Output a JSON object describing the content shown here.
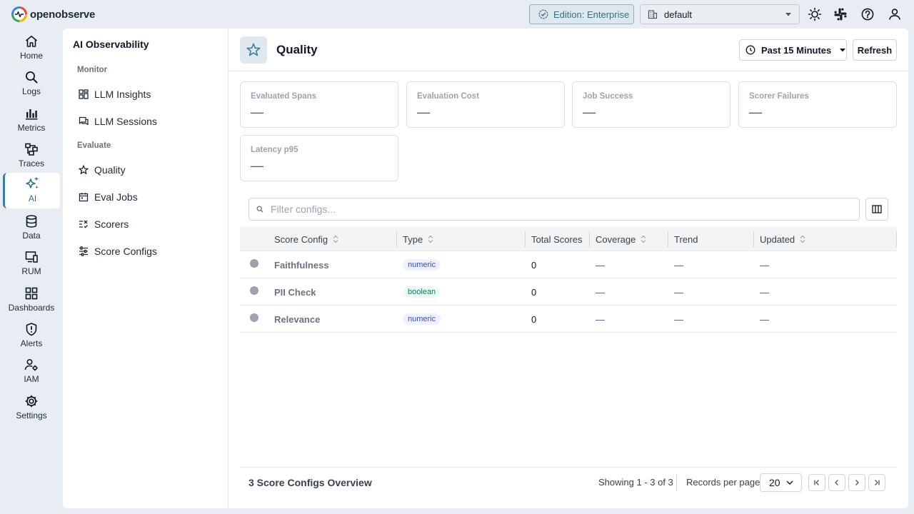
{
  "app": {
    "logo_text": "openobserve"
  },
  "topbar": {
    "edition_label": "Edition: Enterprise",
    "org_name": "default",
    "icons": [
      "theme-sun-icon",
      "slack-icon",
      "help-icon",
      "user-icon"
    ]
  },
  "leftnav": {
    "items": [
      {
        "label": "Home",
        "icon": "home-icon"
      },
      {
        "label": "Logs",
        "icon": "search-icon"
      },
      {
        "label": "Metrics",
        "icon": "bar-chart-icon"
      },
      {
        "label": "Traces",
        "icon": "traces-icon"
      },
      {
        "label": "AI",
        "icon": "sparkles-icon",
        "active": true
      },
      {
        "label": "Data",
        "icon": "database-icon"
      },
      {
        "label": "RUM",
        "icon": "devices-icon"
      },
      {
        "label": "Dashboards",
        "icon": "dashboard-icon"
      },
      {
        "label": "Alerts",
        "icon": "shield-alert-icon"
      },
      {
        "label": "IAM",
        "icon": "users-gear-icon"
      },
      {
        "label": "Settings",
        "icon": "gear-icon"
      }
    ]
  },
  "subnav": {
    "title": "AI Observability",
    "sections": [
      {
        "label": "Monitor",
        "items": [
          {
            "label": "LLM Insights",
            "icon": "grid-icon"
          },
          {
            "label": "LLM Sessions",
            "icon": "chat-icon"
          }
        ]
      },
      {
        "label": "Evaluate",
        "items": [
          {
            "label": "Quality",
            "icon": "star-icon"
          },
          {
            "label": "Eval Jobs",
            "icon": "calendar-icon"
          },
          {
            "label": "Scorers",
            "icon": "checklist-icon"
          },
          {
            "label": "Score Configs",
            "icon": "sliders-icon"
          }
        ]
      }
    ]
  },
  "header": {
    "title": "Quality",
    "time_range": "Past 15 Minutes",
    "refresh_label": "Refresh"
  },
  "cards": [
    {
      "label": "Evaluated Spans",
      "value": "—"
    },
    {
      "label": "Evaluation Cost",
      "value": "—"
    },
    {
      "label": "Job Success",
      "value": "—"
    },
    {
      "label": "Scorer Failures",
      "value": "—"
    },
    {
      "label": "Latency p95",
      "value": "—"
    }
  ],
  "filter": {
    "placeholder": "Filter configs..."
  },
  "table": {
    "columns": [
      "Score Config",
      "Type",
      "Total Scores",
      "Coverage",
      "Trend",
      "Updated"
    ],
    "rows": [
      {
        "name": "Faithfulness",
        "type": "numeric",
        "total": "0",
        "coverage": "—",
        "trend": "—",
        "updated": "—"
      },
      {
        "name": "PII Check",
        "type": "boolean",
        "total": "0",
        "coverage": "—",
        "trend": "—",
        "updated": "—"
      },
      {
        "name": "Relevance",
        "type": "numeric",
        "total": "0",
        "coverage": "—",
        "trend": "—",
        "updated": "—"
      }
    ]
  },
  "footer": {
    "title": "3 Score Configs Overview",
    "showing": "Showing 1 - 3 of 3",
    "rpp_label": "Records per page",
    "rpp_value": "20"
  },
  "colors": {
    "accent": "#3d7f99",
    "background": "#e7edf3",
    "panel": "#ffffff"
  }
}
